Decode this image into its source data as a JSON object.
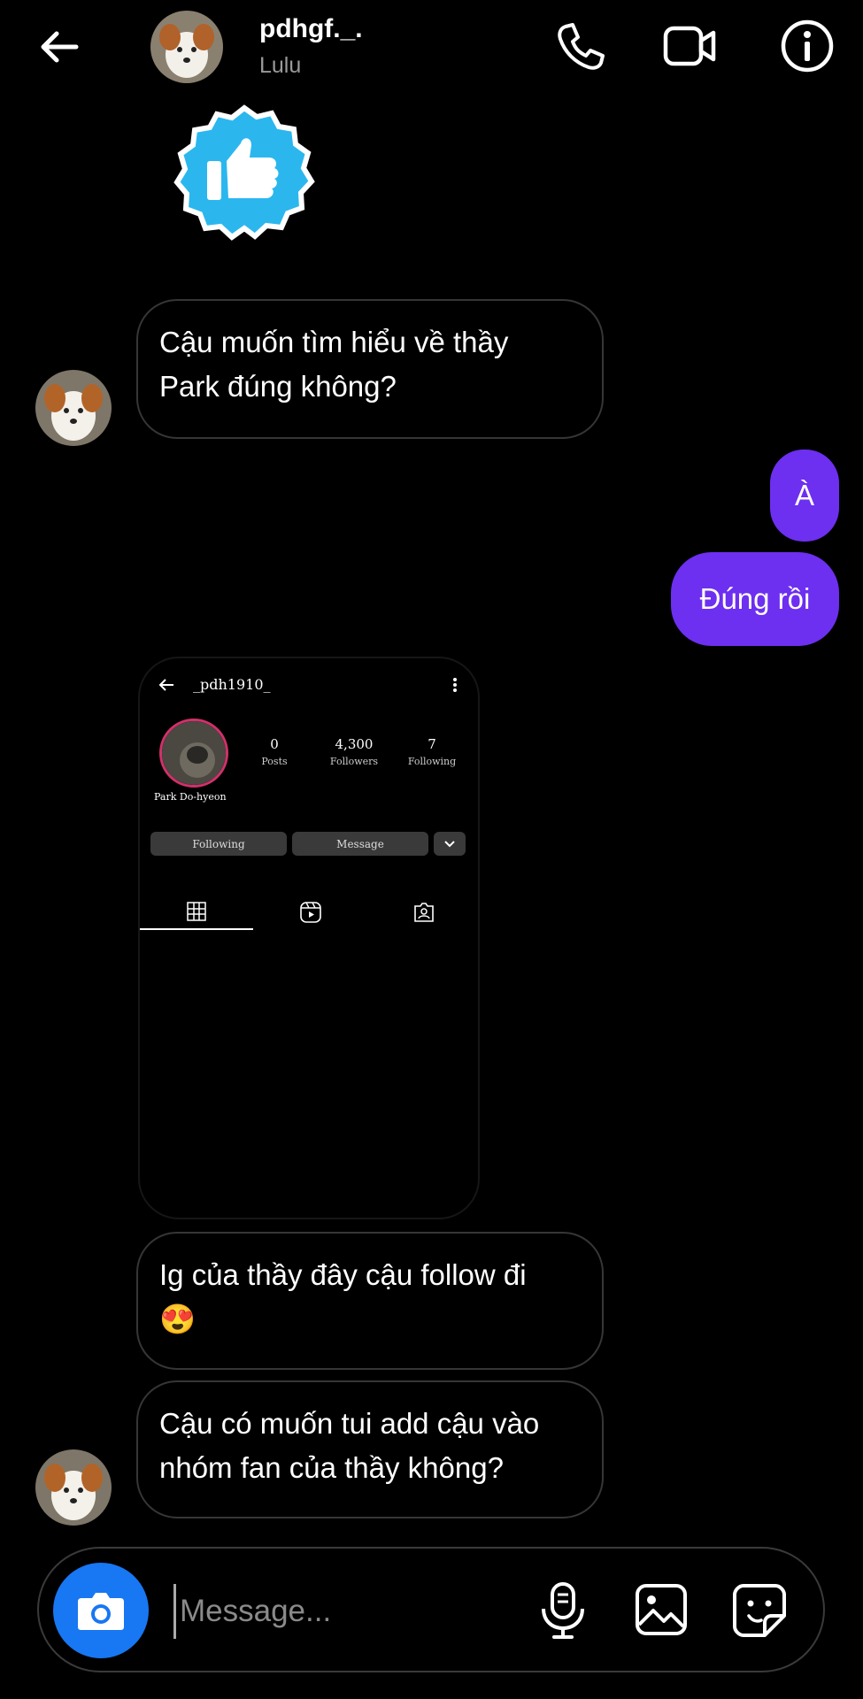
{
  "header": {
    "username": "pdhgf._.",
    "subtitle": "Lulu"
  },
  "messages": {
    "in_1": {
      "line1": "Cậu muốn tìm hiểu về thầy",
      "line2": "Park đúng không?"
    },
    "out_1": "À",
    "out_2": "Đúng rồi",
    "in_2": {
      "line1": "Ig của thầy đây cậu follow đi",
      "emoji": "😍"
    },
    "in_3": {
      "line1": "Cậu có muốn tui add cậu vào",
      "line2": "nhóm fan của thầy không?"
    }
  },
  "shared_profile": {
    "handle": "_pdh1910_",
    "display_name": "Park Do-hyeon",
    "posts_count": "0",
    "posts_label": "Posts",
    "followers_count": "4,300",
    "followers_label": "Followers",
    "following_count": "7",
    "following_label": "Following",
    "following_button": "Following",
    "message_button": "Message"
  },
  "composer": {
    "placeholder": "Message..."
  },
  "colors": {
    "outgoing_bubble": "#6d2ff0",
    "camera_button": "#1877f2",
    "like_sticker": "#2bb7ee"
  },
  "icons": [
    "back-arrow-icon",
    "phone-icon",
    "video-camera-icon",
    "info-icon",
    "thumbs-up-sticker",
    "camera-icon",
    "microphone-icon",
    "gallery-icon",
    "sticker-icon"
  ]
}
